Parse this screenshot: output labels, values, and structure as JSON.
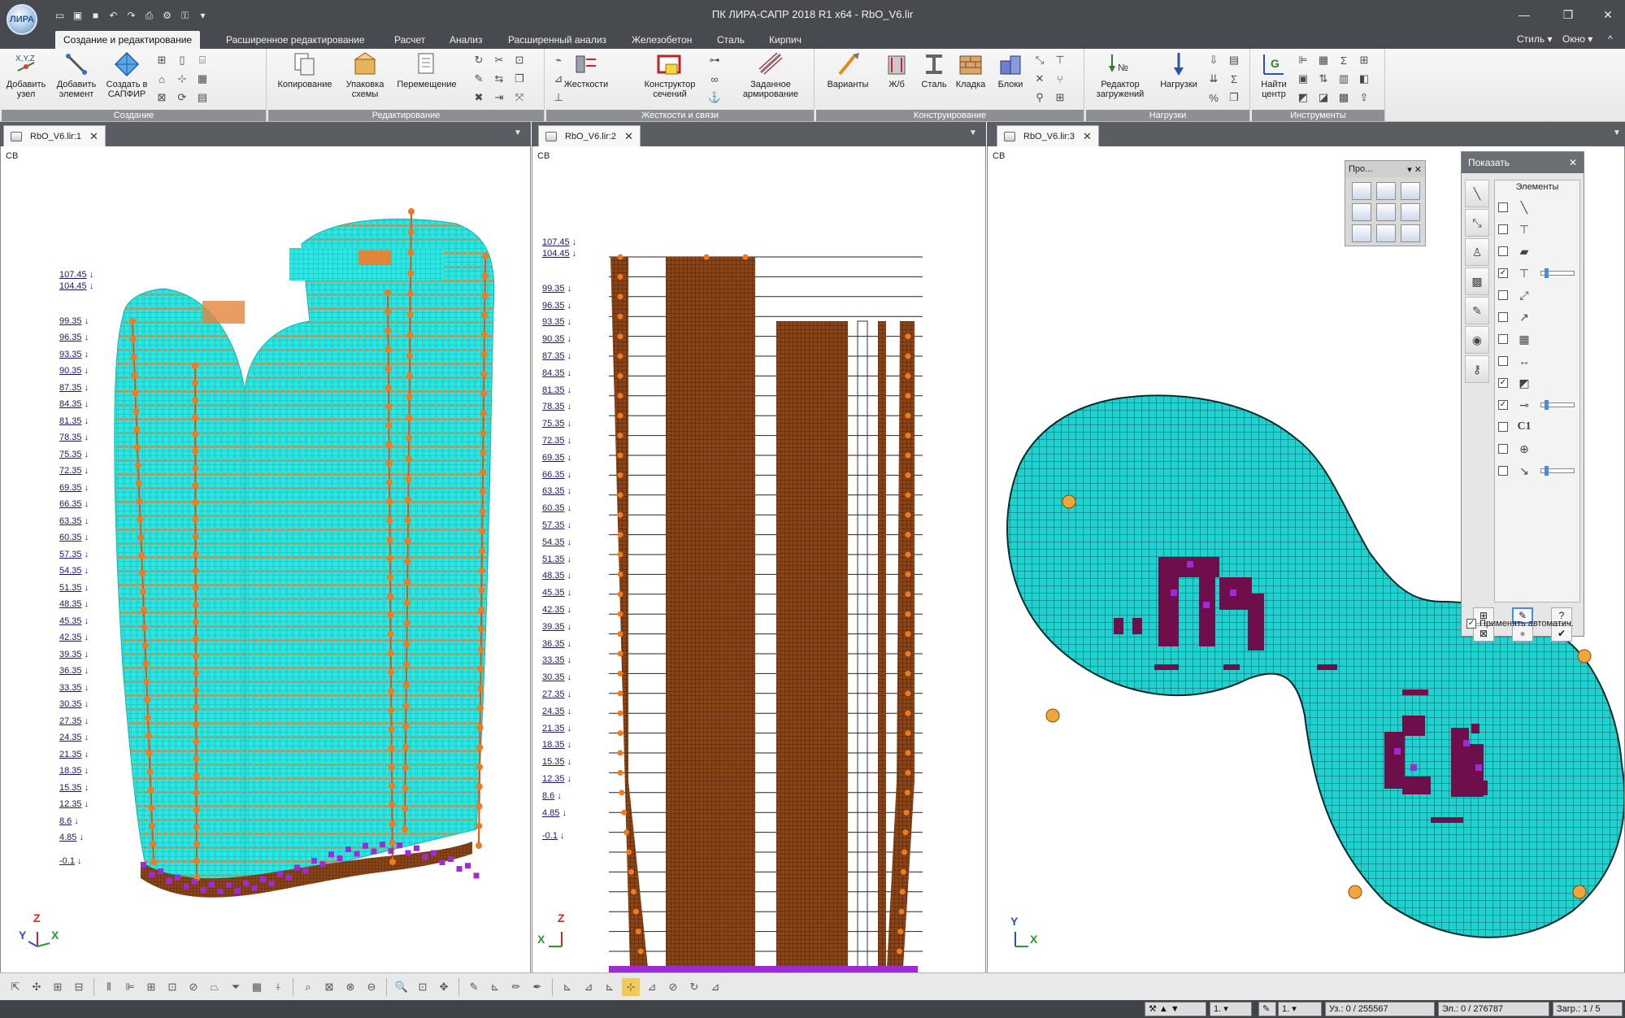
{
  "window": {
    "title": "ПК ЛИРА-САПР  2018 R1 x64 - RbO_V6.lir",
    "logo_text": "ЛИРА"
  },
  "quick_access": [
    "new-icon",
    "open-icon",
    "save-icon",
    "undo-icon",
    "redo-icon",
    "print-icon",
    "settings-icon",
    "lock-icon"
  ],
  "ribbon_tabs": [
    "Создание и редактирование",
    "Расширенное редактирование",
    "Расчет",
    "Анализ",
    "Расширенный анализ",
    "Железобетон",
    "Сталь",
    "Кирпич"
  ],
  "right_menus": {
    "style": "Стиль",
    "window": "Окно"
  },
  "groups": {
    "create": {
      "label": "Создание",
      "buttons": [
        {
          "label": "Добавить узел",
          "icon": "xyz-node-icon"
        },
        {
          "label": "Добавить элемент",
          "icon": "add-element-icon"
        },
        {
          "label": "Создать в САПФИР",
          "icon": "sapfir-icon"
        }
      ]
    },
    "edit": {
      "label": "Редактирование",
      "buttons": [
        {
          "label": "Копирование",
          "icon": "copy-icon"
        },
        {
          "label": "Упаковка схемы",
          "icon": "pack-icon"
        },
        {
          "label": "Перемещение",
          "icon": "move-icon"
        }
      ]
    },
    "stiffness": {
      "label": "Жесткости и связи",
      "buttons": [
        {
          "label": "Жесткости",
          "icon": "stiffness-icon"
        },
        {
          "label": "Конструктор сечений",
          "icon": "section-builder-icon"
        },
        {
          "label": "Заданное армирование",
          "icon": "reinforcement-icon"
        }
      ]
    },
    "construct": {
      "label": "Конструирование",
      "buttons": [
        {
          "label": "Варианты",
          "icon": "variants-icon"
        },
        {
          "label": "Ж/б",
          "icon": "rc-icon"
        },
        {
          "label": "Сталь",
          "icon": "steel-icon"
        },
        {
          "label": "Кладка",
          "icon": "masonry-icon"
        },
        {
          "label": "Блоки",
          "icon": "blocks-icon"
        }
      ]
    },
    "loads": {
      "label": "Нагрузки",
      "buttons": [
        {
          "label": "Редактор загружений",
          "icon": "load-editor-icon"
        },
        {
          "label": "Нагрузки",
          "icon": "loads-icon"
        }
      ]
    },
    "tools": {
      "label": "Инструменты",
      "buttons": [
        {
          "label": "Найти центр",
          "icon": "find-center-icon"
        }
      ]
    }
  },
  "doc_tabs": [
    "RbO_V6.lir:1",
    "RbO_V6.lir:2",
    "RbO_V6.lir:3"
  ],
  "view_label": "СВ",
  "elevations_view1": [
    "107.45",
    "104.45",
    "99.35",
    "96.35",
    "93.35",
    "90.35",
    "87.35",
    "84.35",
    "81.35",
    "78.35",
    "75.35",
    "72.35",
    "69.35",
    "66.35",
    "63.35",
    "60.35",
    "57.35",
    "54.35",
    "51.35",
    "48.35",
    "45.35",
    "42.35",
    "39.35",
    "36.35",
    "33.35",
    "30.35",
    "27.35",
    "24.35",
    "21.35",
    "18.35",
    "15.35",
    "12.35",
    "8.6",
    "4.85",
    "-0.1"
  ],
  "elevations_view2": [
    "107.45",
    "104.45",
    "99.35",
    "96.35",
    "93.35",
    "90.35",
    "87.35",
    "84.35",
    "81.35",
    "78.35",
    "75.35",
    "72.35",
    "69.35",
    "66.35",
    "63.35",
    "60.35",
    "57.35",
    "54.35",
    "51.35",
    "48.35",
    "45.35",
    "42.35",
    "39.35",
    "36.35",
    "33.35",
    "30.35",
    "27.35",
    "24.35",
    "21.35",
    "18.35",
    "15.35",
    "12.35",
    "8.6",
    "4.85",
    "-0.1"
  ],
  "axes": {
    "view1": {
      "y": "Y",
      "z": "Z",
      "x": "X"
    },
    "view2": {
      "z": "Z",
      "x": "X"
    },
    "view3": {
      "y": "Y",
      "x": "X"
    }
  },
  "pro_panel": {
    "title": "Про..."
  },
  "show_panel": {
    "title": "Показать",
    "list_header": "Элементы",
    "rows": [
      {
        "checked": false,
        "icon": "bar-icon"
      },
      {
        "checked": false,
        "icon": "beam-icon"
      },
      {
        "checked": false,
        "icon": "plate-icon"
      },
      {
        "checked": true,
        "icon": "hinge-icon",
        "slider": true
      },
      {
        "checked": false,
        "icon": "local-axes-icon"
      },
      {
        "checked": false,
        "icon": "arrow-icon"
      },
      {
        "checked": false,
        "icon": "mesh-icon"
      },
      {
        "checked": false,
        "icon": "dimension-icon"
      },
      {
        "checked": true,
        "icon": "layer-icon"
      },
      {
        "checked": true,
        "icon": "spring-icon",
        "slider": true
      },
      {
        "checked": false,
        "icon": "c1-icon",
        "text": "C1"
      },
      {
        "checked": false,
        "icon": "node-number-icon"
      },
      {
        "checked": false,
        "icon": "length-icon",
        "slider": true
      }
    ],
    "apply_auto": "Применять автоматич.",
    "apply_checked": true
  },
  "status": {
    "combo1": "1.",
    "combo2": "1.",
    "nodes": "Уз.: 0 / 255567",
    "elements": "Эл.: 0 / 276787",
    "loads": "Загр.: 1 / 5"
  },
  "colors": {
    "mesh": "#1de5e0",
    "mesh_dark": "#0a8a8a",
    "column": "#f07a1f",
    "rc_brown": "#7a3c10",
    "support": "#a12ad8",
    "opening": "#6e0f4c"
  }
}
